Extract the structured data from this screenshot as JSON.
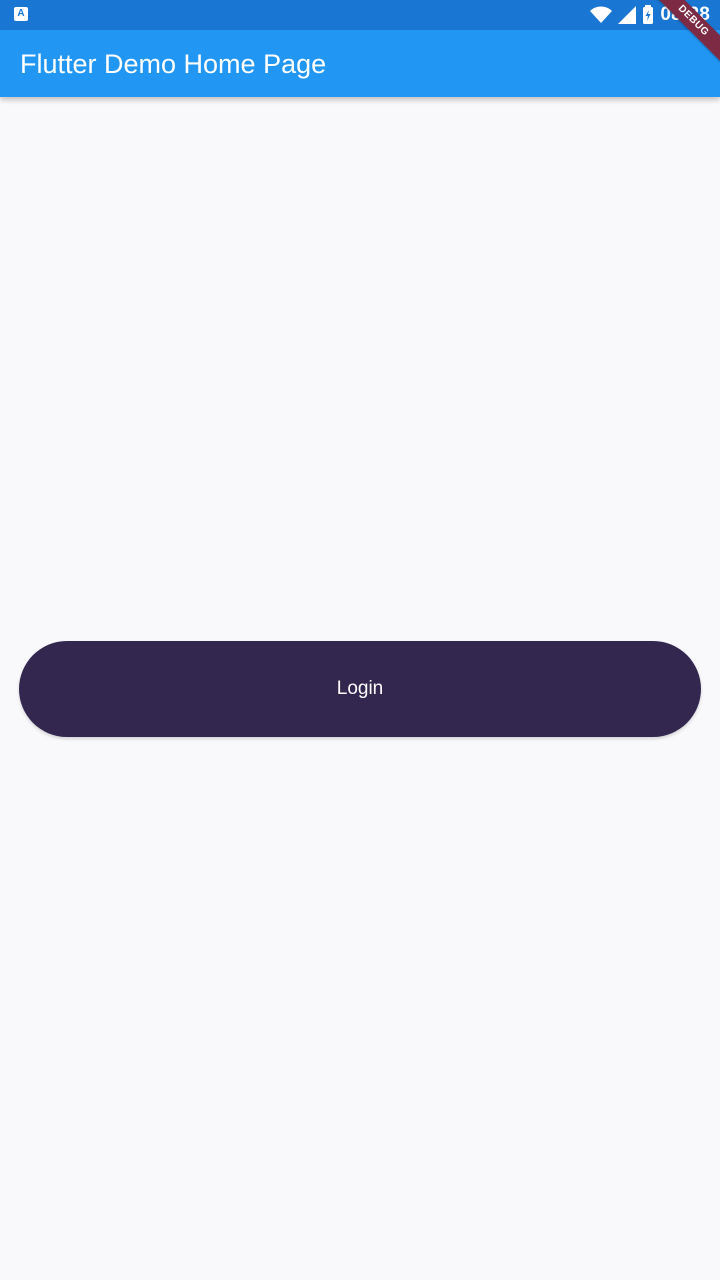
{
  "status_bar": {
    "notification_icon": "a-icon",
    "time": "08:28",
    "signal_icons": [
      "wifi-icon",
      "cell-signal-icon",
      "battery-icon"
    ]
  },
  "app_bar": {
    "title": "Flutter Demo Home Page",
    "color": "#2196f3"
  },
  "debug_banner": {
    "label": "DEBUG"
  },
  "main": {
    "login_label": "Login",
    "login_color": "#33264f"
  }
}
